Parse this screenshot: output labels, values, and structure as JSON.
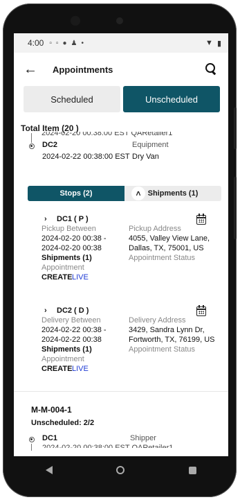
{
  "status_bar": {
    "time": "4:00",
    "icons": [
      "sim-icon",
      "sim-icon",
      "dot-icon",
      "pin-icon",
      "dot-icon"
    ],
    "right_icons": [
      "wifi-icon",
      "battery-icon"
    ]
  },
  "app_bar": {
    "title": "Appointments",
    "back_icon": "arrow-left-icon",
    "search_icon": "search-icon"
  },
  "segments": {
    "scheduled": "Scheduled",
    "unscheduled": "Unscheduled",
    "active": "unscheduled"
  },
  "total_label": "Total Item (20 )",
  "partial_top": {
    "clipped_line": "2024-02-20 00:38:00 EST  QARetailer1",
    "location": "DC2",
    "type": "Equipment",
    "datetime": "2024-02-22 00:38:00 EST",
    "type_value": "Dry Van"
  },
  "tabs": {
    "stops": "Stops (2)",
    "shipments": "Shipments (1)",
    "active": "stops"
  },
  "stops": [
    {
      "title": "DC1 ( P )",
      "window_label": "Pickup Between",
      "window_start": "2024-02-20 00:38 -",
      "window_end": "2024-02-20 00:38",
      "address_label": "Pickup Address",
      "address_line1": "4055, Valley View Lane,",
      "address_line2": "Dallas, TX, 75001, US",
      "appt_status_label": "Appointment Status",
      "shipments": "Shipments (1)",
      "appointment_label": "Appointment",
      "create_label": "CREATE",
      "live_label": "LIVE"
    },
    {
      "title": "DC2 ( D )",
      "window_label": "Delivery Between",
      "window_start": "2024-02-22 00:38 -",
      "window_end": "2024-02-22 00:38",
      "address_label": "Delivery Address",
      "address_line1": "3429, Sandra Lynn Dr,",
      "address_line2": "Fortworth, TX, 76199, US",
      "appt_status_label": "Appointment Status",
      "shipments": "Shipments (1)",
      "appointment_label": "Appointment",
      "create_label": "CREATE",
      "live_label": "LIVE"
    }
  ],
  "next_card": {
    "id": "M-M-004-1",
    "unscheduled": "Unscheduled: 2/2",
    "location": "DC1",
    "role": "Shipper",
    "clipped_line": "2024-02-20 00:38:00 EST  QARetailer1"
  },
  "colors": {
    "primary": "#0f5566",
    "link": "#1e3ad4",
    "label_grey": "#888888"
  }
}
